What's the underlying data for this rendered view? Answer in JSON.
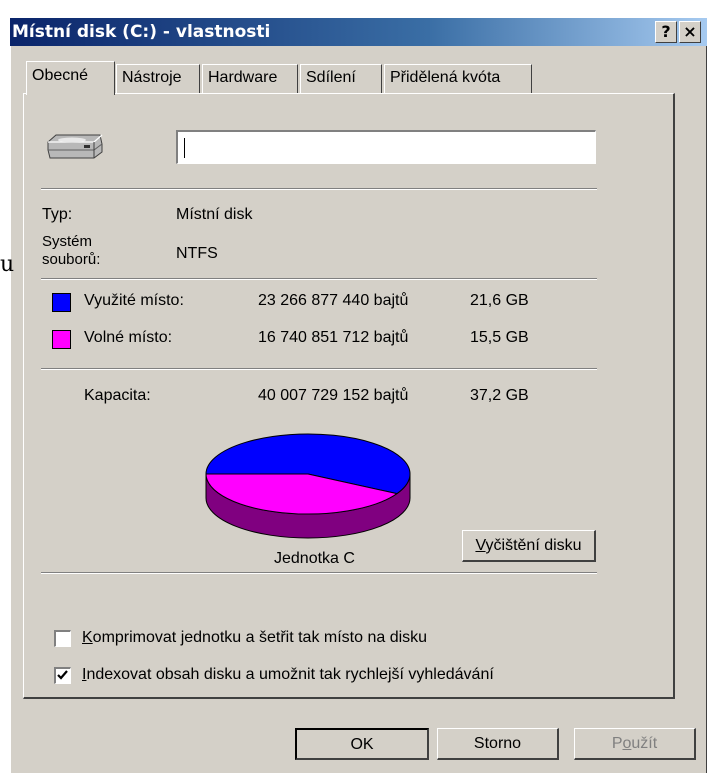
{
  "window": {
    "title": "Místní disk (C:) - vlastnosti",
    "help_button": "?",
    "close_button": "×"
  },
  "edge_text": "u",
  "tabs": [
    {
      "label": "Obecné",
      "active": true
    },
    {
      "label": "Nástroje",
      "active": false
    },
    {
      "label": "Hardware",
      "active": false
    },
    {
      "label": "Sdílení",
      "active": false
    },
    {
      "label": "Přidělená kvóta",
      "active": false
    }
  ],
  "general": {
    "drive_icon": "hard-drive-icon",
    "name_value": "",
    "type_label": "Typ:",
    "type_value": "Místní disk",
    "fs_label_line1": "Systém",
    "fs_label_line2": "souborů:",
    "fs_value": "NTFS",
    "used_label": "Využité místo:",
    "used_bytes": "23 266 877 440 bajtů",
    "used_gb": "21,6 GB",
    "free_label": "Volné místo:",
    "free_bytes": "16 740 851 712 bajtů",
    "free_gb": "15,5 GB",
    "capacity_label": "Kapacita:",
    "capacity_bytes": "40 007 729 152 bajtů",
    "capacity_gb": "37,2 GB",
    "drive_label": "Jednotka C",
    "cleanup_button": "Vyčištění disku",
    "compress_label": "Komprimovat jednotku a šetřit tak místo na disku",
    "compress_checked": false,
    "index_label": "Indexovat obsah disku a umožnit tak rychlejší vyhledávání",
    "index_checked": true
  },
  "colors": {
    "used": "#0000ff",
    "free": "#ff00ff",
    "used_side": "#000080",
    "free_side": "#800080"
  },
  "chart_data": {
    "type": "pie",
    "categories": [
      "Využité místo",
      "Volné místo"
    ],
    "values": [
      23266877440,
      16740851712
    ]
  },
  "buttons": {
    "ok": "OK",
    "cancel": "Storno",
    "apply": "Použít"
  }
}
